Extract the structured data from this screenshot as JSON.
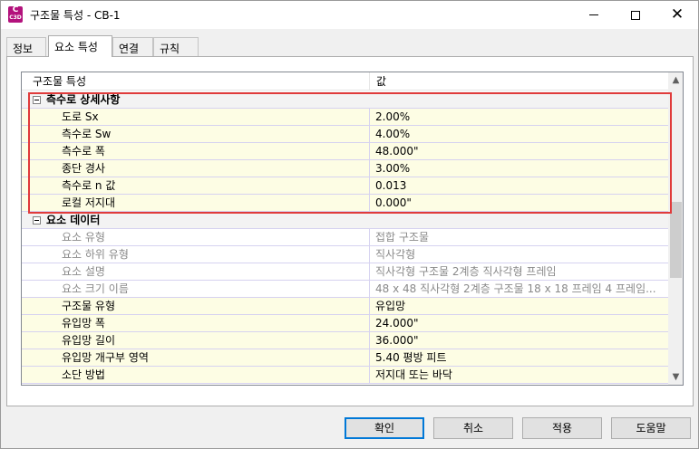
{
  "window": {
    "title": "구조물 특성 - CB-1",
    "icon": {
      "name": "civil3d-app-icon",
      "letter": "C",
      "sub": "C3D",
      "color": "#b3127c"
    }
  },
  "tabs": [
    {
      "label": "정보",
      "active": false
    },
    {
      "label": "요소 특성",
      "active": true
    },
    {
      "label": "연결",
      "active": false
    },
    {
      "label": "규칙",
      "active": false
    }
  ],
  "grid": {
    "headers": {
      "name": "구조물 특성",
      "value": "값"
    },
    "categories": [
      {
        "label": "측수로 상세사항",
        "rows": [
          {
            "name": "도로 Sx",
            "value": "2.00%",
            "disabled": false
          },
          {
            "name": "측수로 Sw",
            "value": "4.00%",
            "disabled": false
          },
          {
            "name": "측수로 폭",
            "value": "48.000\"",
            "disabled": false
          },
          {
            "name": "종단 경사",
            "value": "3.00%",
            "disabled": false
          },
          {
            "name": "측수로 n 값",
            "value": "0.013",
            "disabled": false
          },
          {
            "name": "로컬 저지대",
            "value": "0.000\"",
            "disabled": false
          }
        ]
      },
      {
        "label": "요소 데이터",
        "rows": [
          {
            "name": "요소 유형",
            "value": "접합 구조물",
            "disabled": true
          },
          {
            "name": "요소 하위 유형",
            "value": "직사각형",
            "disabled": true
          },
          {
            "name": "요소 설명",
            "value": "직사각형 구조물 2계층 직사각형 프레임",
            "disabled": true
          },
          {
            "name": "요소 크기 이름",
            "value": "48 x 48 직사각형 2계층 구조물 18 x 18 프레임 4 프레임...",
            "disabled": true
          },
          {
            "name": "구조물 유형",
            "value": "유입망",
            "disabled": false
          },
          {
            "name": "유입망 폭",
            "value": "24.000\"",
            "disabled": false
          },
          {
            "name": "유입망 길이",
            "value": "36.000\"",
            "disabled": false
          },
          {
            "name": "유입망 개구부 영역",
            "value": "5.40 평방 피트",
            "disabled": false
          },
          {
            "name": "소단 방법",
            "value": "저지대 또는 바닥",
            "disabled": false
          }
        ]
      }
    ]
  },
  "buttons": {
    "ok": "확인",
    "cancel": "취소",
    "apply": "적용",
    "help": "도움말"
  },
  "colors": {
    "highlight": "#e03b3b",
    "primary_button_border": "#0078d7",
    "property_row_bg": "#fdfde4"
  }
}
